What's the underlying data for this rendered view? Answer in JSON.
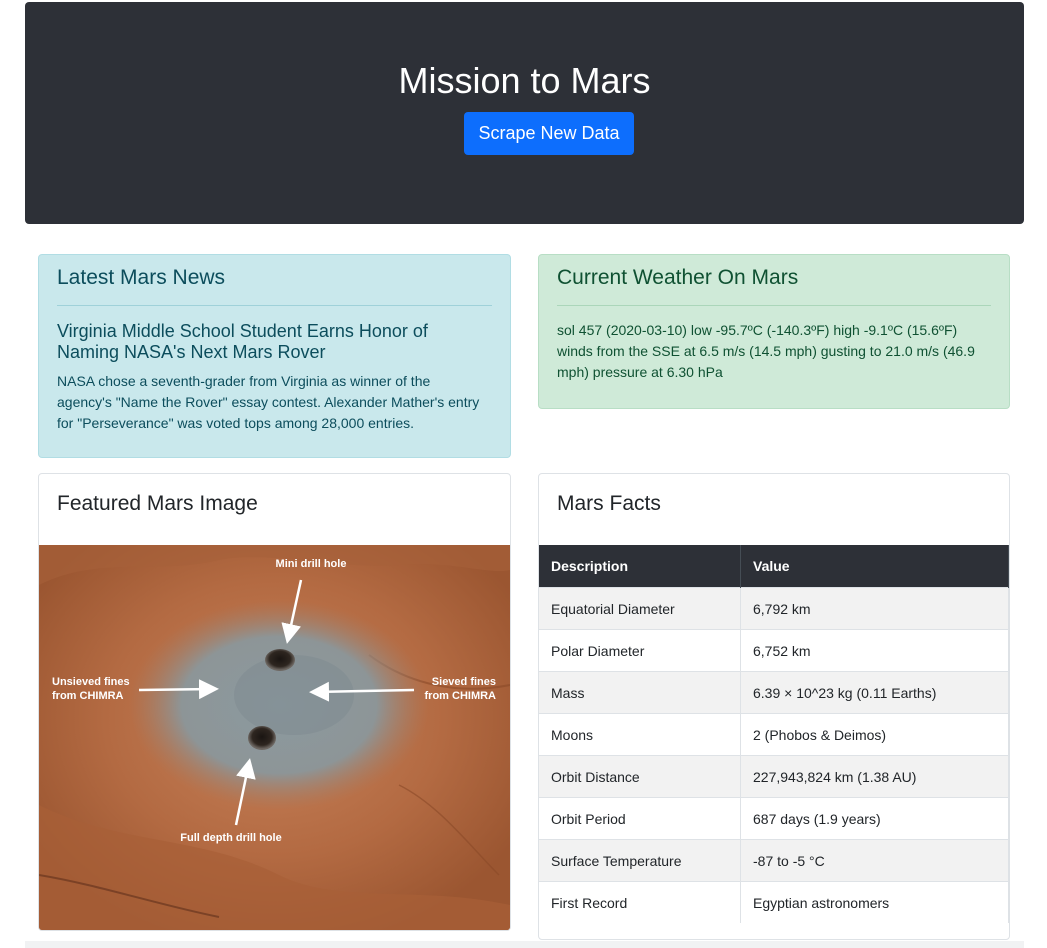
{
  "header": {
    "title": "Mission to Mars",
    "scrape_button": "Scrape New Data"
  },
  "news": {
    "heading": "Latest Mars News",
    "title": "Virginia Middle School Student Earns Honor of Naming NASA's Next Mars Rover",
    "body": "NASA chose a seventh-grader from Virginia as winner of the agency's \"Name the Rover\" essay contest. Alexander Mather's entry for \"Perseverance\" was voted tops among 28,000 entries."
  },
  "weather": {
    "heading": "Current Weather On Mars",
    "body": "sol 457 (2020-03-10) low -95.7ºC (-140.3ºF) high -9.1ºC (15.6ºF) winds from the SSE at 6.5 m/s (14.5 mph) gusting to 21.0 m/s (46.9 mph) pressure at 6.30 hPa"
  },
  "featured_image": {
    "heading": "Featured Mars Image",
    "labels": {
      "mini": "Mini drill hole",
      "unsieved_1": "Unsieved fines",
      "unsieved_2": "from CHIMRA",
      "sieved_1": "Sieved fines",
      "sieved_2": "from CHIMRA",
      "full": "Full depth drill hole"
    }
  },
  "facts": {
    "heading": "Mars Facts",
    "columns": [
      "Description",
      "Value"
    ],
    "rows": [
      [
        "Equatorial Diameter",
        "6,792 km"
      ],
      [
        "Polar Diameter",
        "6,752 km"
      ],
      [
        "Mass",
        "6.39 × 10^23 kg (0.11 Earths)"
      ],
      [
        "Moons",
        "2 (Phobos & Deimos)"
      ],
      [
        "Orbit Distance",
        "227,943,824 km (1.38 AU)"
      ],
      [
        "Orbit Period",
        "687 days (1.9 years)"
      ],
      [
        "Surface Temperature",
        "-87 to -5 °C"
      ],
      [
        "First Record",
        "Egyptian astronomers"
      ]
    ]
  },
  "colors": {
    "jumbotron": "#2d3037",
    "primary_button": "#0d6efd",
    "info_bg": "#c9e8ec",
    "success_bg": "#cfead8"
  }
}
